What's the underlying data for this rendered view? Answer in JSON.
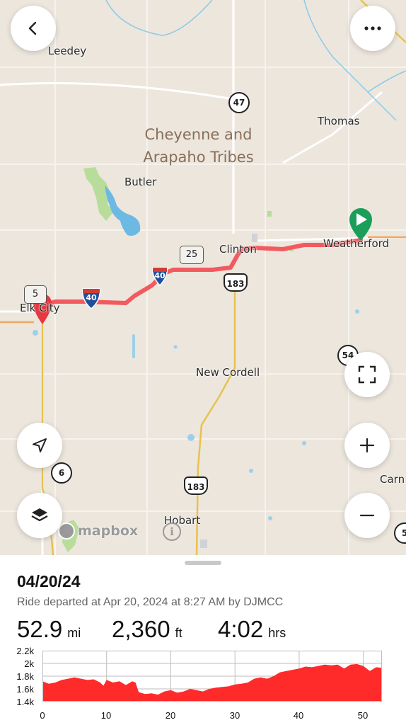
{
  "map": {
    "places": {
      "leedey": "Leedey",
      "thomas": "Thomas",
      "butler": "Butler",
      "clinton": "Clinton",
      "weatherford": "Weatherford",
      "elk_city": "Elk City",
      "new_cordell": "New Cordell",
      "hobart": "Hobart",
      "carn": "Carn",
      "region_line1": "Cheyenne and",
      "region_line2": "Arapaho Tribes"
    },
    "shields": {
      "sh47": "47",
      "sh25": "25",
      "i40_a": "40",
      "i40_b": "40",
      "us183_a": "183",
      "us183_b": "183",
      "sh6": "6",
      "sh54": "54",
      "sh5": "5",
      "sh5_right": "5"
    },
    "attribution": "mapbox",
    "route_color": "#f25a5f",
    "start_marker_color": "#1a9e5a",
    "end_marker_color": "#e8373f"
  },
  "ride": {
    "date": "04/20/24",
    "description": "Ride departed at Apr 20, 2024 at 8:27 AM by DJMCC",
    "distance_value": "52.9",
    "distance_unit": "mi",
    "elevation_value": "2,360",
    "elevation_unit": "ft",
    "duration_value": "4:02",
    "duration_unit": "hrs"
  },
  "chart_data": {
    "type": "area",
    "xlabel": "",
    "ylabel": "",
    "x_tick_labels": [
      "0",
      "10",
      "20",
      "30",
      "40",
      "50"
    ],
    "y_tick_labels": [
      "2.2k",
      "2k",
      "1.8k",
      "1.6k",
      "1.4k"
    ],
    "x_ticks": [
      0,
      10,
      20,
      30,
      40,
      50
    ],
    "y_ticks": [
      2200,
      2000,
      1800,
      1600,
      1400
    ],
    "xlim": [
      0,
      52.9
    ],
    "ylim": [
      1400,
      2200
    ],
    "fill_color": "#ff2a2a",
    "grid": true,
    "series": [
      {
        "x": [
          0,
          1,
          2,
          3,
          4,
          5,
          6,
          7,
          8,
          9,
          9.5,
          10,
          11,
          12,
          13,
          14,
          14.5,
          15,
          16,
          17,
          18,
          19,
          20,
          21,
          22,
          23,
          24,
          25,
          26,
          27,
          28,
          29,
          30,
          31,
          32,
          33,
          34,
          35,
          36,
          37,
          38,
          39,
          40,
          41,
          42,
          43,
          44,
          45,
          46,
          47,
          48,
          49,
          50,
          51,
          52,
          52.9
        ],
        "y": [
          1720,
          1680,
          1700,
          1740,
          1760,
          1780,
          1760,
          1740,
          1750,
          1700,
          1650,
          1740,
          1700,
          1720,
          1660,
          1720,
          1700,
          1550,
          1520,
          1530,
          1510,
          1560,
          1580,
          1540,
          1560,
          1600,
          1580,
          1560,
          1600,
          1620,
          1630,
          1640,
          1670,
          1680,
          1700,
          1760,
          1780,
          1760,
          1800,
          1860,
          1880,
          1900,
          1920,
          1950,
          1940,
          1960,
          1980,
          1970,
          1980,
          1920,
          1980,
          1990,
          1960,
          1880,
          1940,
          1930
        ]
      }
    ]
  }
}
